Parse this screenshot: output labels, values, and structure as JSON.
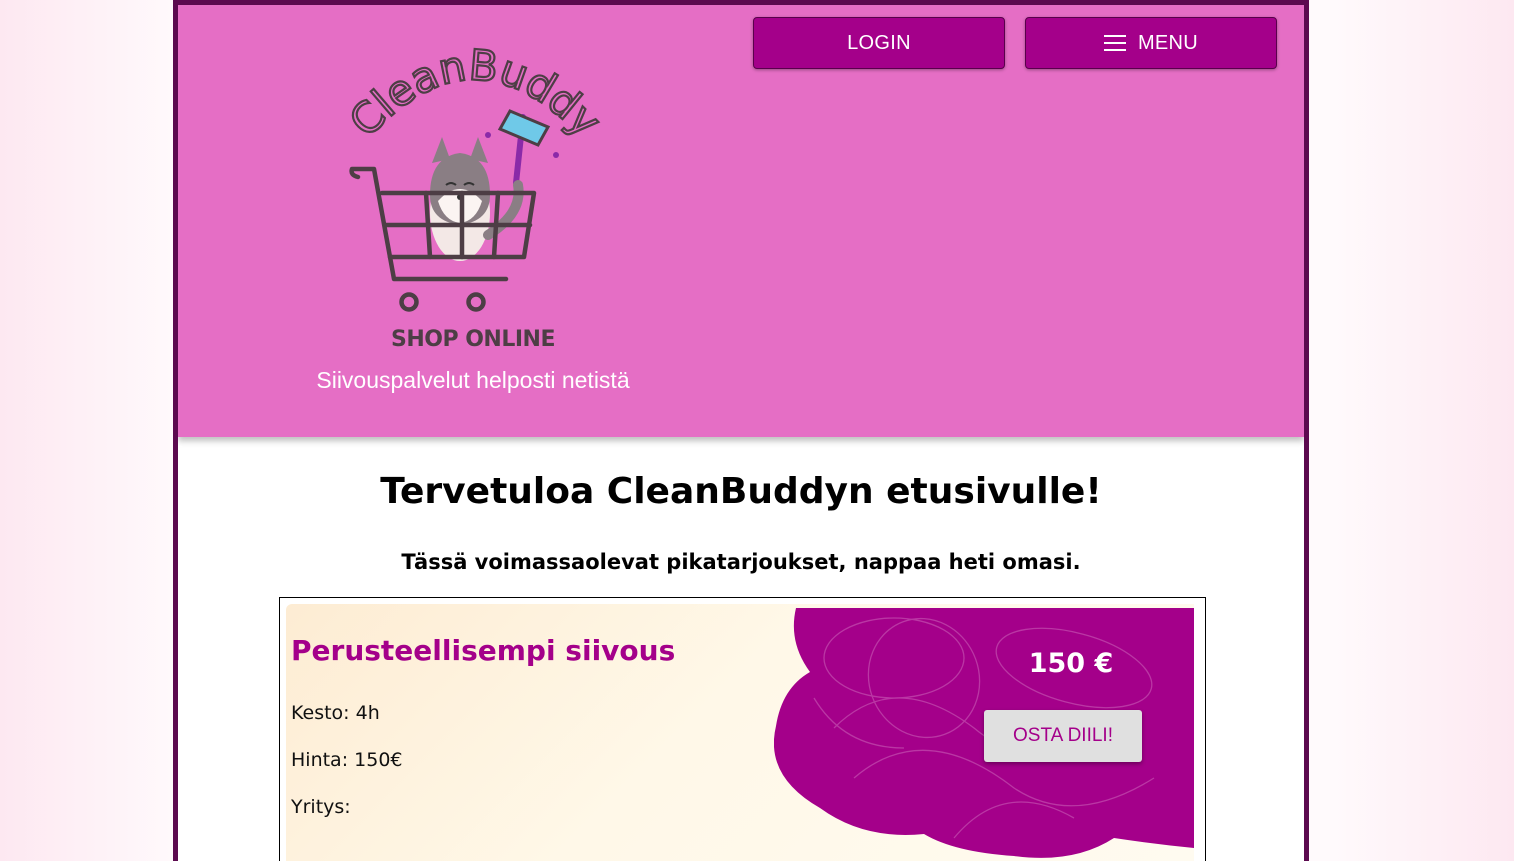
{
  "header": {
    "login_label": "LOGIN",
    "menu_label": "MENU",
    "logo_text": "CleanBuddy",
    "shop_online": "SHOP ONLINE",
    "tagline": "Siivouspalvelut helposti netistä"
  },
  "main": {
    "welcome": "Tervetuloa CleanBuddyn etusivulle!",
    "intro": "Tässä voimassaolevat pikatarjoukset, nappaa heti omasi."
  },
  "deal": {
    "title": "Perusteellisempi siivous",
    "duration": "Kesto: 4h",
    "price_line": "Hinta: 150€",
    "company": "Yritys:",
    "price_badge": "150 €",
    "buy_label": "OSTA DIILI!"
  },
  "colors": {
    "header_bg": "#e56ec5",
    "accent": "#a4008a",
    "frame": "#5c0a4f",
    "card_bg": "#fdecd3"
  },
  "icons": [
    "menu-icon",
    "cleanbuddy-logo"
  ]
}
